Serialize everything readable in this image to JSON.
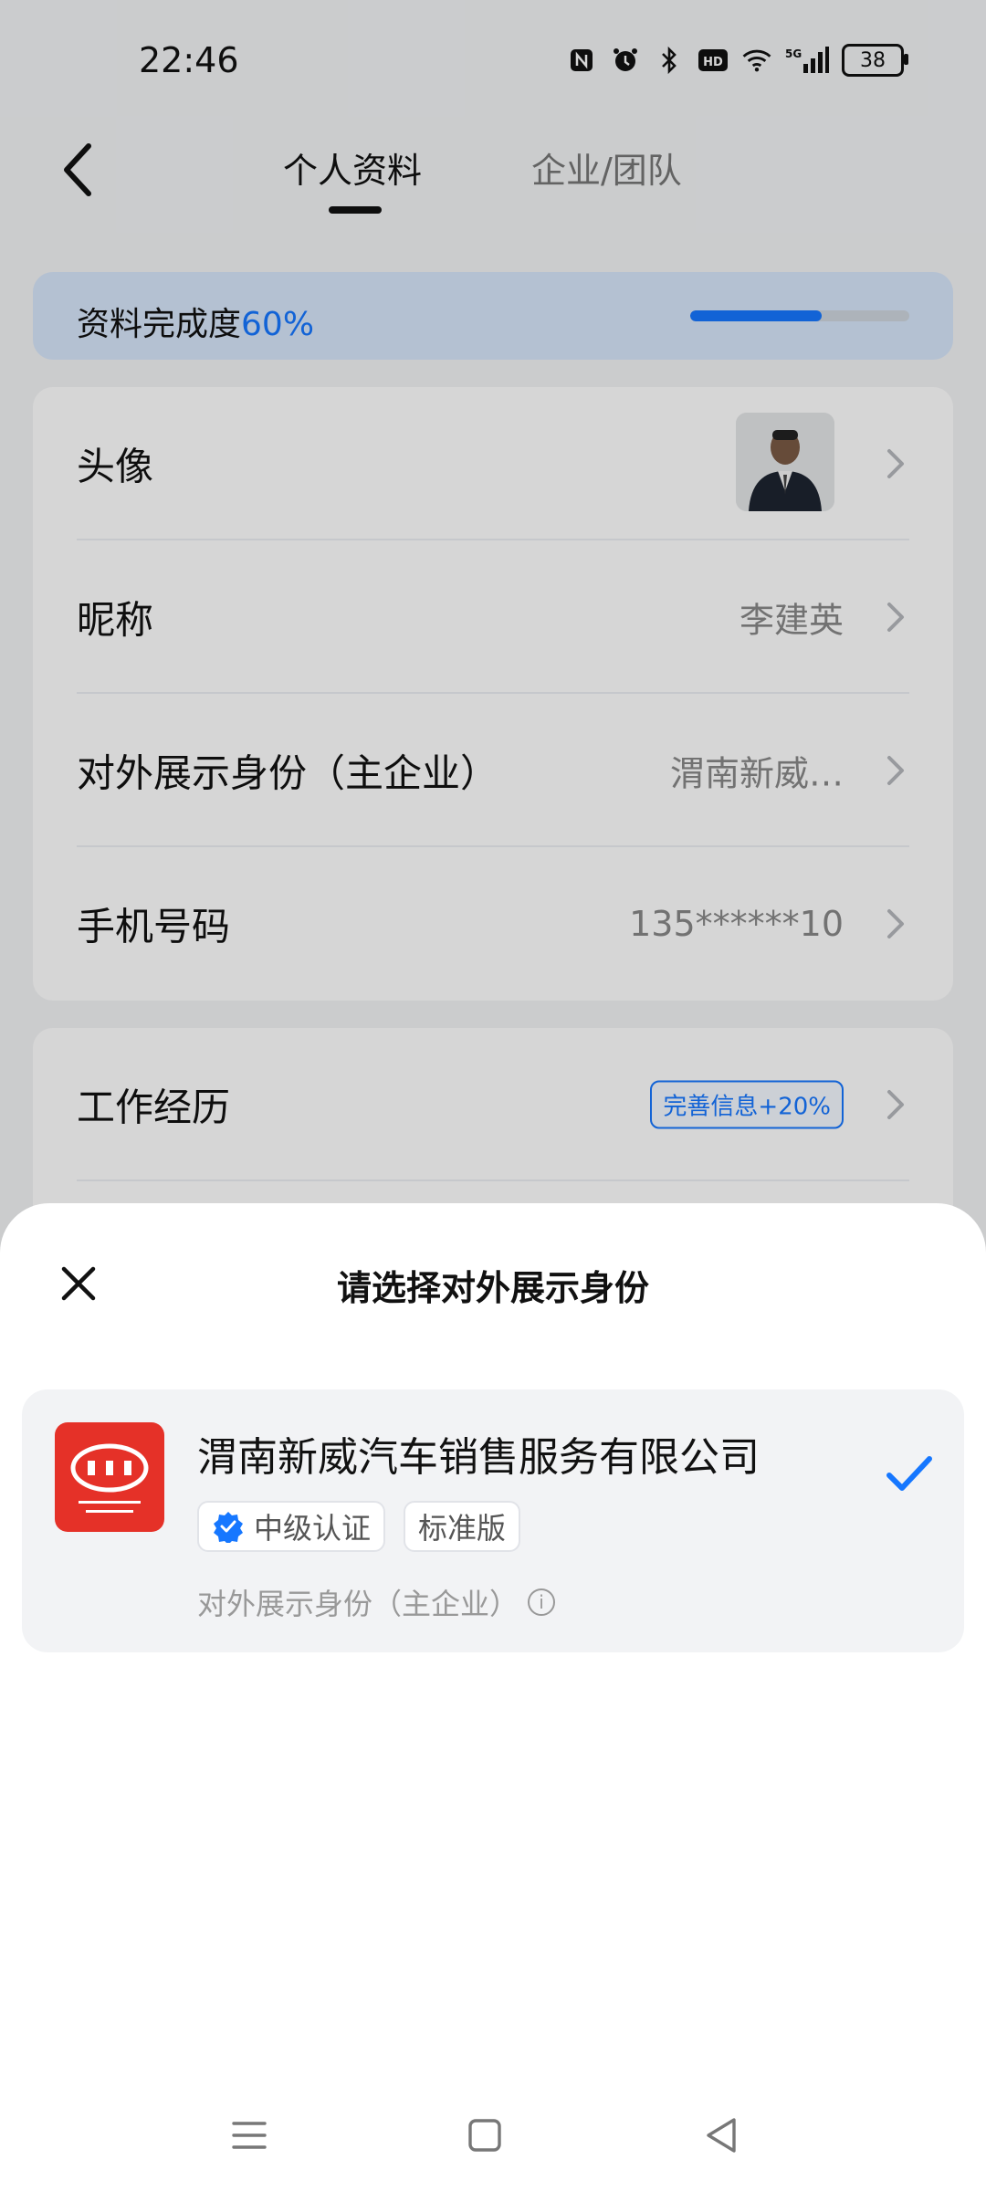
{
  "status_bar": {
    "time": "22:46",
    "icons": [
      "nfc-icon",
      "alarm-icon",
      "bluetooth-icon",
      "hd-icon",
      "wifi-icon",
      "5g-signal-icon"
    ],
    "hd_label": "HD",
    "network_label": "5G",
    "battery_level": "38"
  },
  "header": {
    "tabs": [
      {
        "label": "个人资料",
        "active": true
      },
      {
        "label": "企业/团队",
        "active": false
      }
    ]
  },
  "completion": {
    "label": "资料完成度",
    "percent_text": "60%",
    "progress": 0.6
  },
  "profile": {
    "rows": [
      {
        "label": "头像",
        "value": ""
      },
      {
        "label": "昵称",
        "value": "李建英"
      },
      {
        "label": "对外展示身份（主企业）",
        "value": "渭南新威…"
      },
      {
        "label": "手机号码",
        "value": "135******10"
      }
    ]
  },
  "work": {
    "label": "工作经历",
    "tag": "完善信息+20%"
  },
  "sheet": {
    "title": "请选择对外展示身份",
    "company": {
      "name": "渭南新威汽车销售服务有限公司",
      "badges": [
        "中级认证",
        "标准版"
      ],
      "subtitle": "对外展示身份（主企业）",
      "selected": true
    }
  },
  "colors": {
    "accent": "#1677ff",
    "brand_red": "#e53128",
    "completion_bg": "#d7e6fb",
    "sheet_bg": "#ffffff"
  }
}
